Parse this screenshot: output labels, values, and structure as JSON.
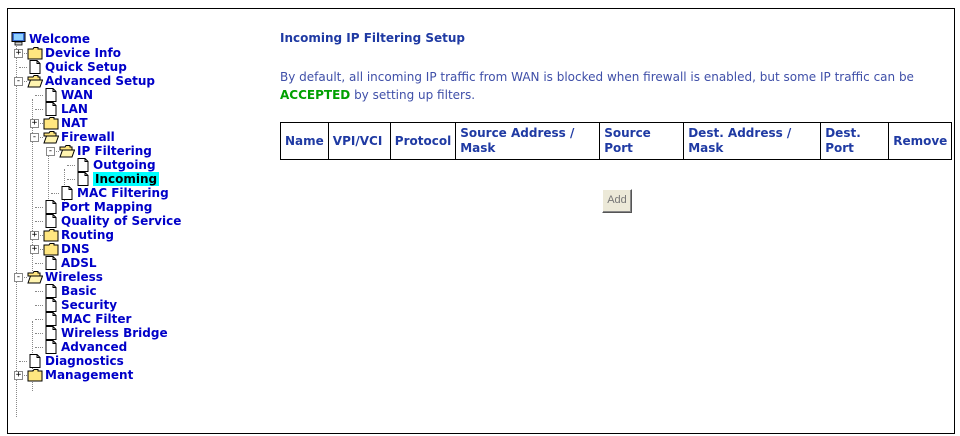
{
  "sidebar": {
    "welcome": "Welcome",
    "items": [
      {
        "label": "Device Info",
        "type": "folder",
        "expander": "+"
      },
      {
        "label": "Quick Setup",
        "type": "page"
      },
      {
        "label": "Advanced Setup",
        "type": "folder-open",
        "expander": "-"
      },
      {
        "label": "WAN",
        "type": "page"
      },
      {
        "label": "LAN",
        "type": "page"
      },
      {
        "label": "NAT",
        "type": "folder",
        "expander": "+"
      },
      {
        "label": "Firewall",
        "type": "folder-open",
        "expander": "-"
      },
      {
        "label": "IP Filtering",
        "type": "folder-open",
        "expander": "-"
      },
      {
        "label": "Outgoing",
        "type": "page"
      },
      {
        "label": "Incoming",
        "type": "page",
        "selected": true
      },
      {
        "label": "MAC Filtering",
        "type": "page"
      },
      {
        "label": "Port Mapping",
        "type": "page"
      },
      {
        "label": "Quality of Service",
        "type": "page"
      },
      {
        "label": "Routing",
        "type": "folder",
        "expander": "+"
      },
      {
        "label": "DNS",
        "type": "folder",
        "expander": "+"
      },
      {
        "label": "ADSL",
        "type": "page"
      },
      {
        "label": "Wireless",
        "type": "folder-open",
        "expander": "-"
      },
      {
        "label": "Basic",
        "type": "page"
      },
      {
        "label": "Security",
        "type": "page"
      },
      {
        "label": "MAC Filter",
        "type": "page"
      },
      {
        "label": "Wireless Bridge",
        "type": "page"
      },
      {
        "label": "Advanced",
        "type": "page"
      },
      {
        "label": "Diagnostics",
        "type": "page"
      },
      {
        "label": "Management",
        "type": "folder",
        "expander": "+"
      }
    ]
  },
  "main": {
    "title": "Incoming IP Filtering Setup",
    "description_before": "By default, all incoming IP traffic from WAN is blocked when firewall is enabled, but some IP traffic can be ",
    "description_accent": "ACCEPTED",
    "description_after": " by setting up filters.",
    "table_headers": [
      "Name",
      "VPI/VCI",
      "Protocol",
      "Source Address / Mask",
      "Source Port",
      "Dest. Address / Mask",
      "Dest. Port",
      "Remove"
    ],
    "add_button": "Add"
  },
  "colors": {
    "link": "#0000c8",
    "heading": "#1f3aa3",
    "accent": "#00a000",
    "selected_bg": "#00ffff"
  }
}
